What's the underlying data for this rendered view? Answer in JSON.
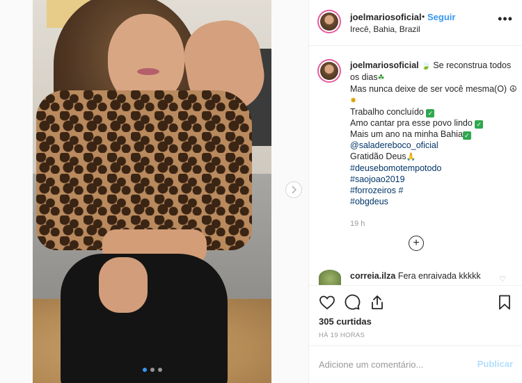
{
  "post": {
    "carousel": {
      "slide_count": 3,
      "active_index": 0
    },
    "header": {
      "username": "joelmariosoficial",
      "separator": "•",
      "follow_label": "Seguir",
      "location": "Irecê, Bahia, Brazil",
      "more_label": "•••"
    },
    "caption": {
      "username": "joelmariosoficial",
      "lines": [
        "Se reconstrua todos os dias",
        "Mas nunca deixe de ser você mesma(O)",
        "Trabalho concluído",
        "Amo cantar pra esse povo lindo",
        "Mais um ano na minha Bahia",
        "@saladereboco_oficial",
        "Gratidão Deus"
      ],
      "hashtags": [
        "#deusebomotempotodo",
        "#saojoao2019",
        "#forrozeiros #",
        "#obgdeus"
      ],
      "time": "19 h"
    },
    "load_more_label": "+",
    "comment": {
      "username": "correia.ilza",
      "text": "Fera enraivada kkkkk"
    },
    "likes": "305 curtidas",
    "posted_ago": "HÁ 19 HORAS",
    "add_comment": {
      "placeholder": "Adicione um comentário...",
      "publish_label": "Publicar"
    }
  },
  "colors": {
    "link": "#3897f0",
    "hashtag": "#003569",
    "publish_disabled": "#b2dffc",
    "avatar_ring": "#e55b9b"
  },
  "icons": [
    "heart-icon",
    "comment-icon",
    "share-icon",
    "bookmark-icon",
    "plus-circle-icon",
    "chevron-right-icon",
    "more-icon"
  ]
}
